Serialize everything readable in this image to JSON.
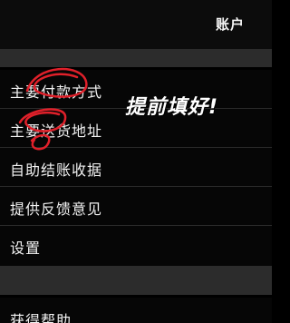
{
  "header": {
    "title": "账户"
  },
  "menu": {
    "items": [
      {
        "label": "主要付款方式"
      },
      {
        "label": "主要送货地址"
      },
      {
        "label": "自助结账收据"
      },
      {
        "label": "提供反馈意见"
      },
      {
        "label": "设置"
      },
      {
        "label": "获得帮助"
      }
    ]
  },
  "annotation": {
    "text": "提前填好!",
    "color": "#e0202a"
  }
}
